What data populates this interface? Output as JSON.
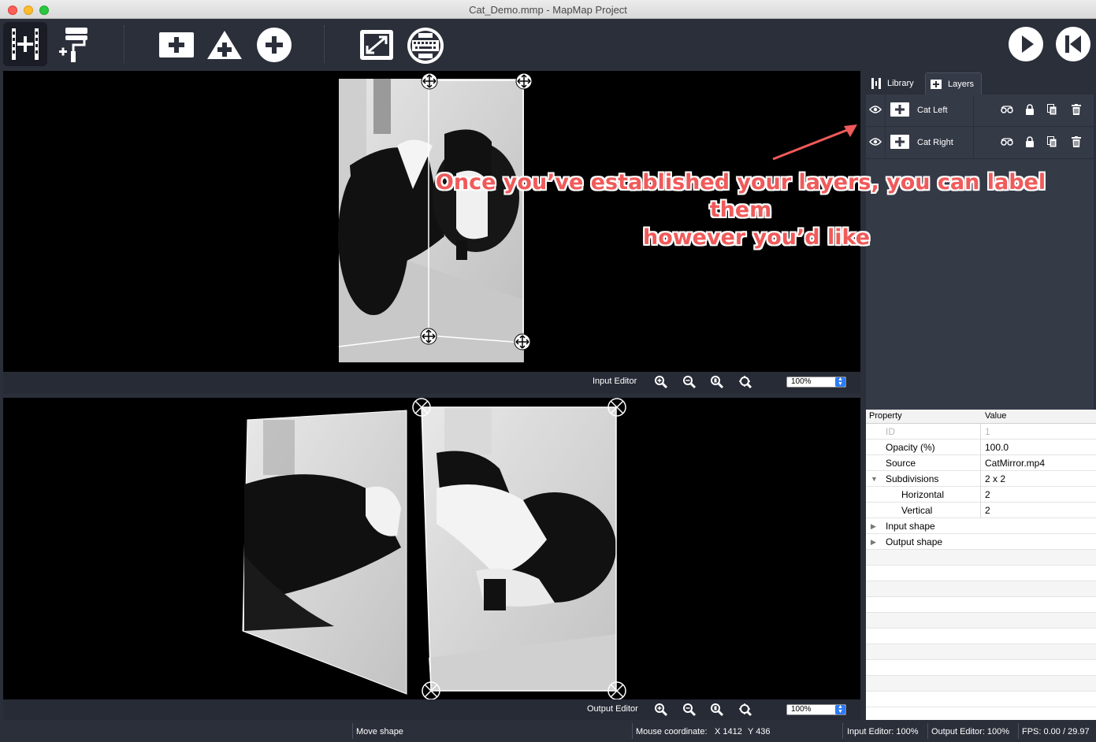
{
  "window": {
    "title": "Cat_Demo.mmp - MapMap Project"
  },
  "toolbar": {
    "buttons": [
      "add-media-icon",
      "add-paint-icon",
      "add-mesh-icon",
      "add-triangle-icon",
      "add-ellipse-icon",
      "fullscreen-icon",
      "sticky-keyboard-icon",
      "play-icon",
      "rewind-icon"
    ]
  },
  "input_editor": {
    "label": "Input Editor",
    "zoom": "100%"
  },
  "output_editor": {
    "label": "Output Editor",
    "zoom": "100%"
  },
  "tabs": [
    {
      "label": "Library",
      "icon": "film-icon"
    },
    {
      "label": "Layers",
      "icon": "plus-square-icon"
    }
  ],
  "layers": [
    {
      "name": "Cat Left"
    },
    {
      "name": "Cat Right"
    }
  ],
  "properties": {
    "header": {
      "property": "Property",
      "value": "Value"
    },
    "rows": [
      {
        "key": "ID",
        "value": "1"
      },
      {
        "key": "Opacity (%)",
        "value": "100.0"
      },
      {
        "key": "Source",
        "value": "CatMirror.mp4"
      },
      {
        "key": "Subdivisions",
        "value": "2 x 2"
      },
      {
        "key": "Horizontal",
        "value": "2"
      },
      {
        "key": "Vertical",
        "value": "2"
      },
      {
        "key": "Input shape",
        "value": ""
      },
      {
        "key": "Output shape",
        "value": ""
      }
    ]
  },
  "status": {
    "action": "Move shape",
    "mouse_label": "Mouse coordinate:",
    "mouse_x": "X 1412",
    "mouse_y": "Y 436",
    "input_zoom": "Input Editor: 100%",
    "output_zoom": "Output Editor: 100%",
    "fps": "FPS: 0.00 / 29.97"
  },
  "annotation": {
    "line1": "Once you’ve established your layers, you can label them",
    "line2": "however you’d like",
    "color": "#f05a5a"
  }
}
